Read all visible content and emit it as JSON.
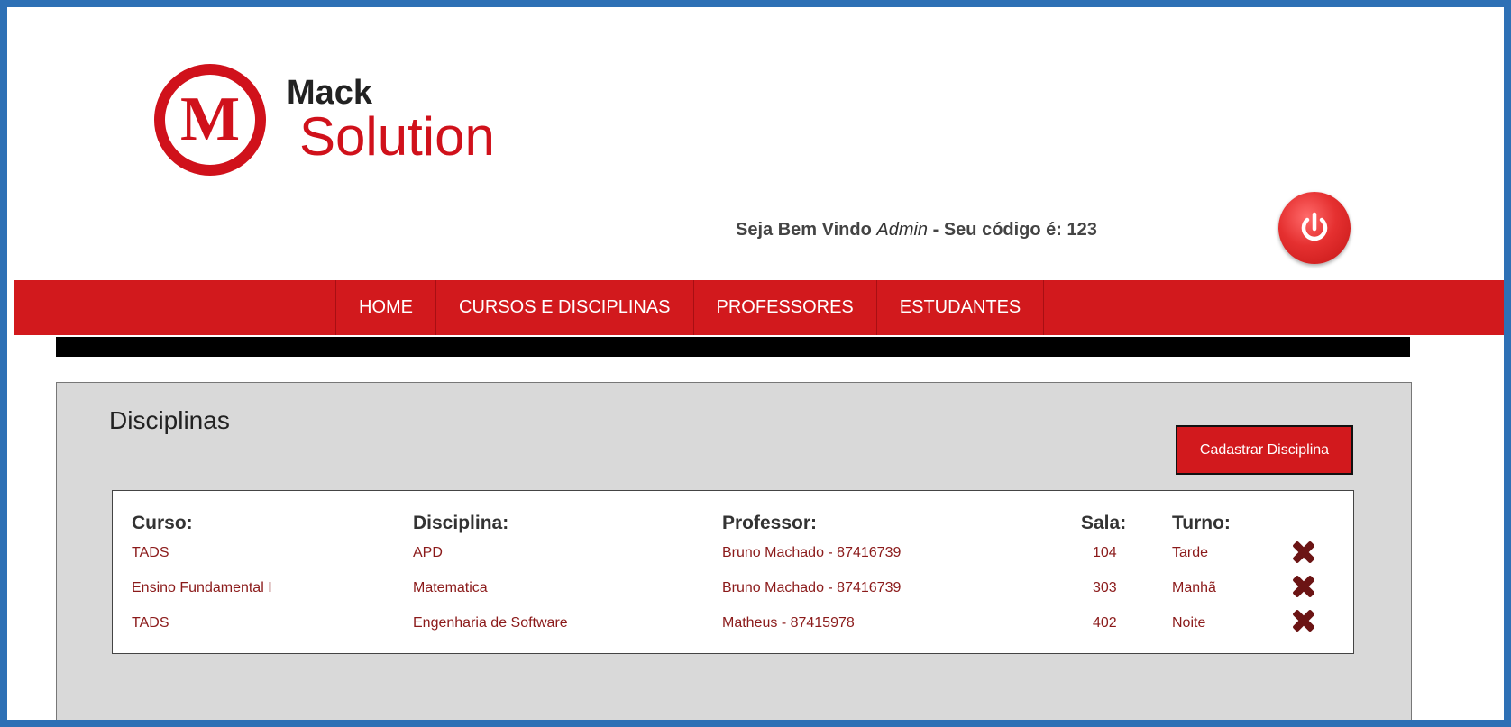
{
  "header": {
    "logo_letter": "M",
    "logo_line1": "Mack",
    "logo_line2": "Solution",
    "welcome_prefix": "Seja Bem Vindo ",
    "welcome_user": "Admin",
    "welcome_suffix": " - Seu código é: 123",
    "logout_icon": "power-icon"
  },
  "nav": {
    "items": [
      {
        "label": "HOME"
      },
      {
        "label": "CURSOS E DISCIPLINAS"
      },
      {
        "label": "PROFESSORES"
      },
      {
        "label": "ESTUDANTES"
      }
    ]
  },
  "main": {
    "title": "Disciplinas",
    "add_button": "Cadastrar Disciplina",
    "table": {
      "headers": [
        "Curso:",
        "Disciplina:",
        "Professor:",
        "Sala:",
        "Turno:"
      ],
      "rows": [
        {
          "curso": "TADS",
          "disciplina": "APD",
          "professor": "Bruno Machado - 87416739",
          "sala": "104",
          "turno": "Tarde"
        },
        {
          "curso": "Ensino Fundamental I",
          "disciplina": "Matematica",
          "professor": "Bruno Machado - 87416739",
          "sala": "303",
          "turno": "Manhã"
        },
        {
          "curso": "TADS",
          "disciplina": "Engenharia de Software",
          "professor": "Matheus - 87415978",
          "sala": "402",
          "turno": "Noite"
        }
      ],
      "delete_icon": "close-x-icon"
    }
  },
  "colors": {
    "brand_red": "#d2191d",
    "frame_blue": "#2e70b5",
    "row_text": "#8b1a1a"
  }
}
